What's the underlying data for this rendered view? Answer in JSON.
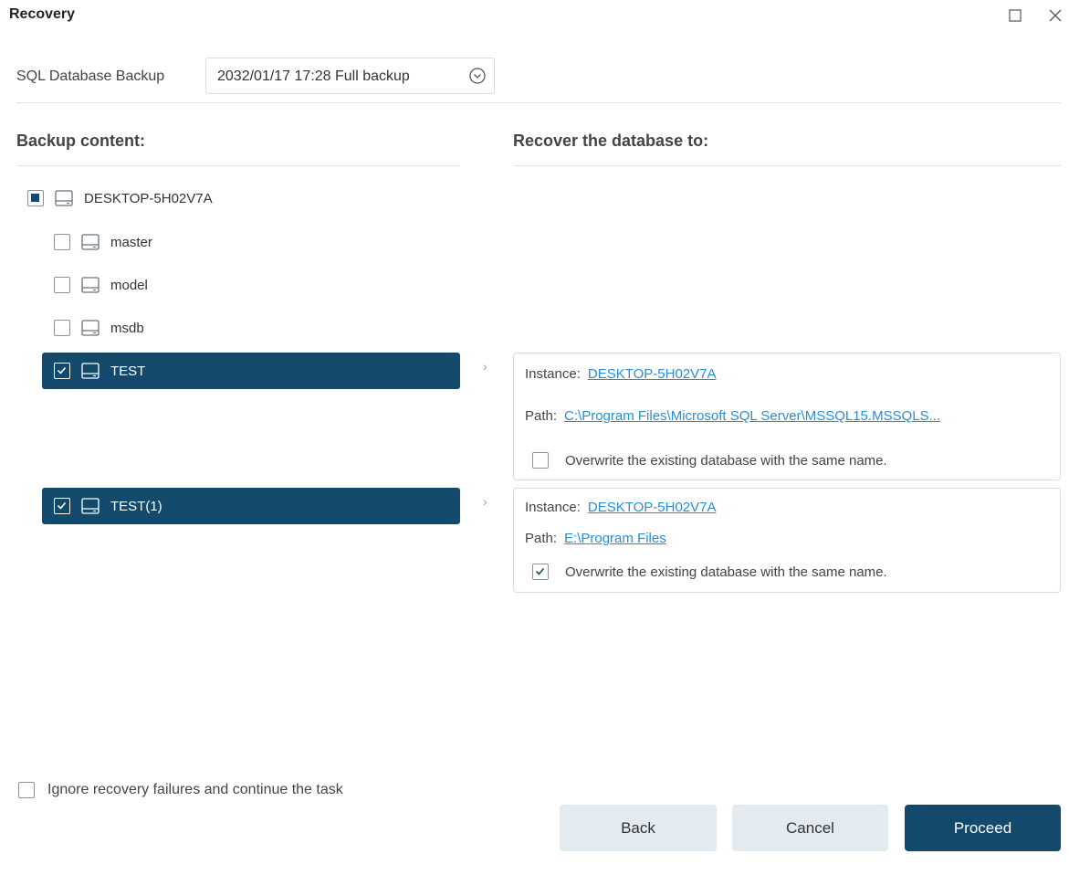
{
  "window": {
    "title": "Recovery",
    "maximize_icon": "maximize-icon",
    "close_icon": "close-icon"
  },
  "source": {
    "label": "SQL Database Backup",
    "selected": "2032/01/17 17:28 Full backup",
    "icon": "chevron-down-circle-icon"
  },
  "backup_content": {
    "title": "Backup content:",
    "root": {
      "label": "DESKTOP-5H02V7A",
      "state": "partial"
    },
    "items": [
      {
        "label": "master",
        "checked": false
      },
      {
        "label": "model",
        "checked": false
      },
      {
        "label": "msdb",
        "checked": false
      },
      {
        "label": "TEST",
        "checked": true
      },
      {
        "label": "TEST(1)",
        "checked": true
      }
    ]
  },
  "recover_to": {
    "title": "Recover the database to:",
    "targets": [
      {
        "instance_label": "Instance:",
        "instance": "DESKTOP-5H02V7A",
        "path_label": "Path:",
        "path": "C:\\Program Files\\Microsoft SQL Server\\MSSQL15.MSSQLS...",
        "overwrite_label": "Overwrite the existing database with the same name.",
        "overwrite": false
      },
      {
        "instance_label": "Instance:",
        "instance": "DESKTOP-5H02V7A",
        "path_label": "Path:",
        "path": "E:\\Program Files",
        "overwrite_label": "Overwrite the existing database with the same name.",
        "overwrite": true
      }
    ]
  },
  "options": {
    "ignore_failures_label": "Ignore recovery failures and continue the task",
    "ignore_failures": false
  },
  "buttons": {
    "back": "Back",
    "cancel": "Cancel",
    "proceed": "Proceed"
  },
  "colors": {
    "accent": "#134a6b",
    "link": "#2a8fd1",
    "secondary_button": "#e3eaf0"
  }
}
